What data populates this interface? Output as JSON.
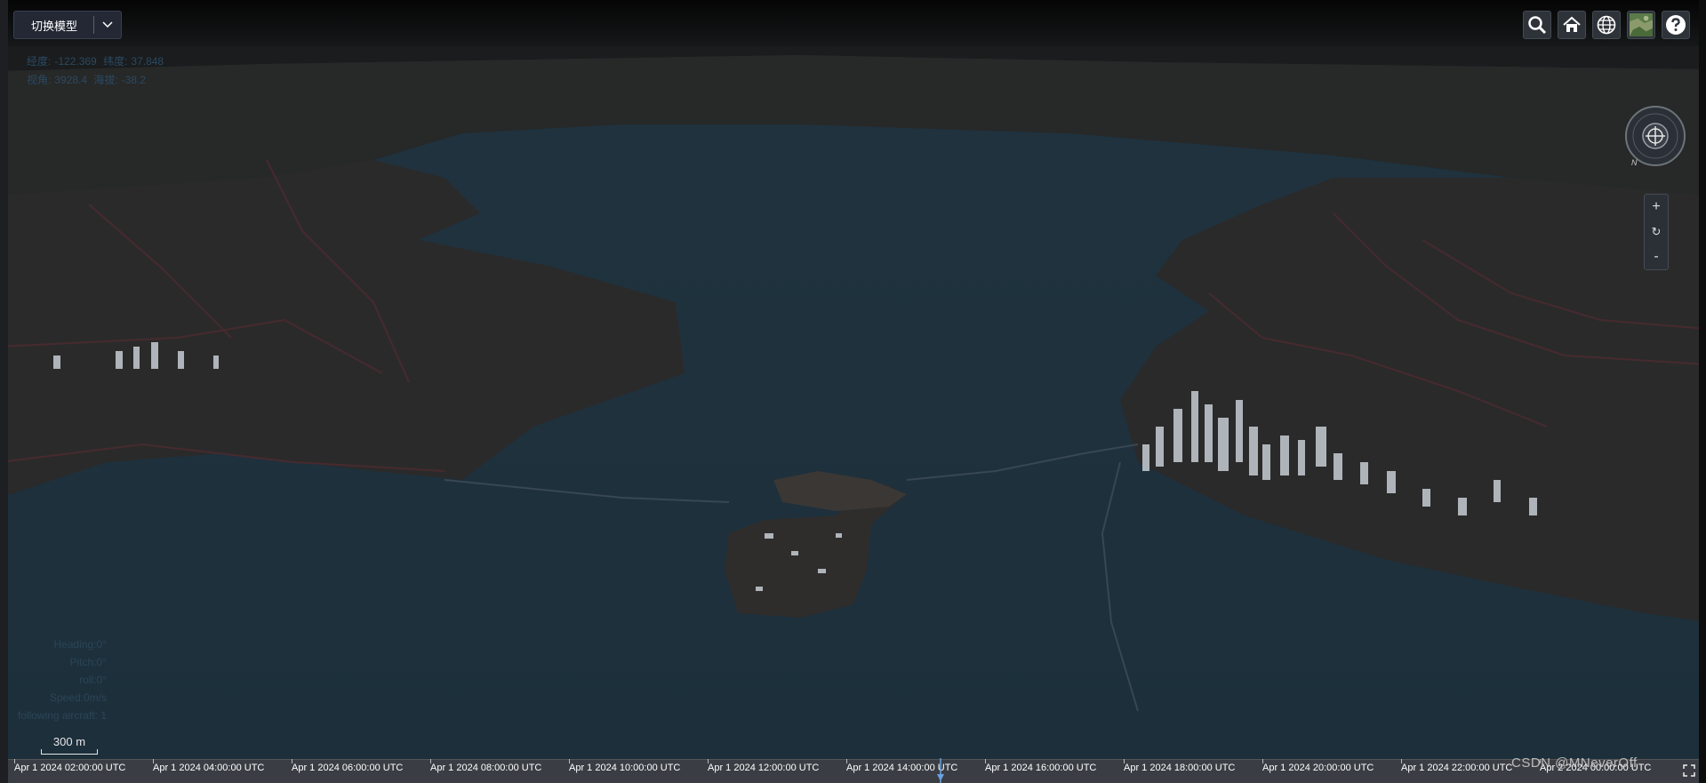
{
  "model_switch": {
    "label": "切换模型"
  },
  "coords": {
    "lon_label": "经度:",
    "lon_value": "-122.369",
    "lat_label": "纬度:",
    "lat_value": "37.848",
    "view_label": "视角:",
    "view_value": "3928.4",
    "alt_label": "海拔:",
    "alt_value": "-38.2"
  },
  "toolbar": {
    "buttons": [
      {
        "icon": "search-icon"
      },
      {
        "icon": "home-icon"
      },
      {
        "icon": "globe-icon"
      },
      {
        "icon": "imagery-layer-icon"
      },
      {
        "icon": "help-icon"
      }
    ]
  },
  "compass": {
    "north_label": "N"
  },
  "zoom": {
    "in": "+",
    "reset": "↻",
    "out": "-"
  },
  "flight_info": {
    "heading": "Heading:0°",
    "pitch": "Pitch:0°",
    "roll": "roll:0°",
    "speed": "Speed:0m/s",
    "following": "following aircraft: 1"
  },
  "scale_bar": {
    "label": "300 m"
  },
  "timeline": {
    "ticks": [
      "Apr 1 2024 02:00:00 UTC",
      "Apr 1 2024 04:00:00 UTC",
      "Apr 1 2024 06:00:00 UTC",
      "Apr 1 2024 08:00:00 UTC",
      "Apr 1 2024 10:00:00 UTC",
      "Apr 1 2024 12:00:00 UTC",
      "Apr 1 2024 14:00:00 UTC",
      "Apr 1 2024 16:00:00 UTC",
      "Apr 1 2024 18:00:00 UTC",
      "Apr 1 2024 20:00:00 UTC",
      "Apr 1 2024 22:00:00 UTC",
      "Apr 2 2024 00:00:00 UTC"
    ]
  },
  "watermark": "CSDN @MNeverOff",
  "colors": {
    "water": "#213441",
    "land": "#2c2b2b",
    "roads": "#4a2a2f",
    "buildings": "#c7cdd4"
  }
}
